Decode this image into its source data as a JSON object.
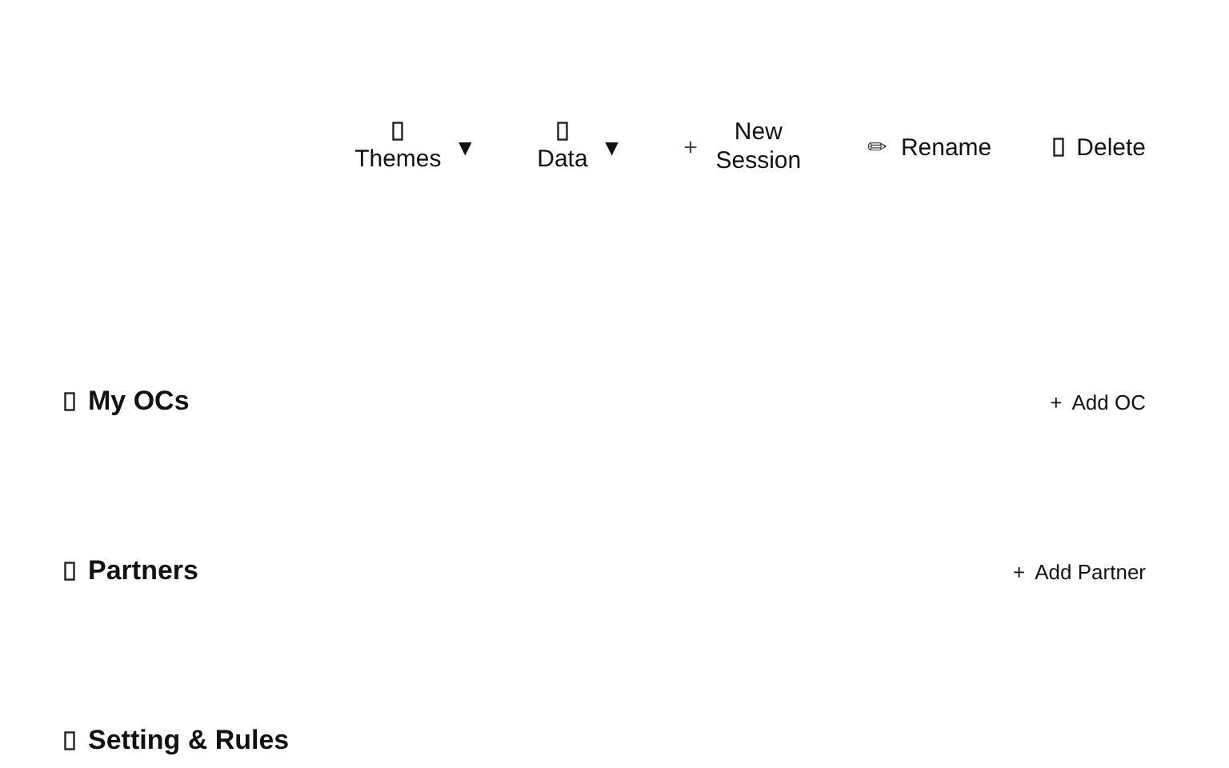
{
  "toolbar": [
    {
      "kind": "menu",
      "label": "Themes",
      "caret": "▼"
    },
    {
      "kind": "menu",
      "label": "Data",
      "caret": "▼"
    },
    {
      "kind": "action",
      "glyph": "+",
      "label": "New Session"
    },
    {
      "kind": "action",
      "glyph": "✏",
      "label": "Rename"
    },
    {
      "kind": "boxed",
      "label": "Delete"
    }
  ],
  "sections": [
    {
      "title": "My OCs",
      "add": {
        "glyph": "+",
        "label": "Add OC"
      }
    },
    {
      "title": "Partners",
      "add": {
        "glyph": "+",
        "label": "Add Partner"
      }
    },
    {
      "title": "Setting & Rules"
    }
  ]
}
